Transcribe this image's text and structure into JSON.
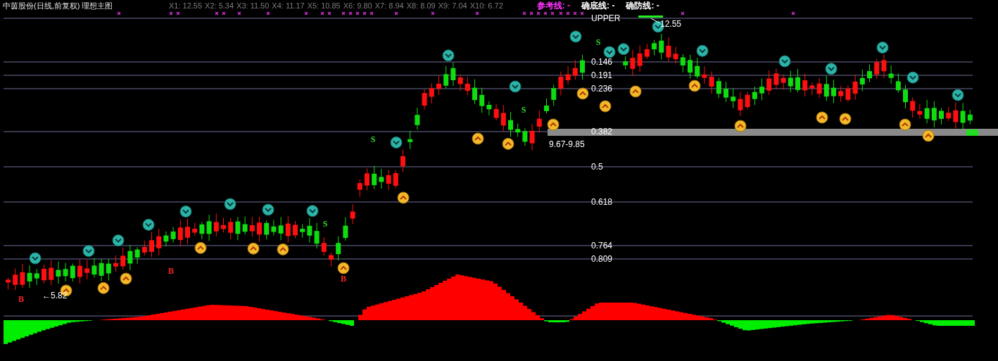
{
  "header": {
    "title": "中茵股份(日线,前复权) 理想主图",
    "indicators": [
      {
        "label": "X1: 12.55"
      },
      {
        "label": "X2: 5.34"
      },
      {
        "label": "X3: 11.50"
      },
      {
        "label": "X4: 11.17"
      },
      {
        "label": "X5: 10.85"
      },
      {
        "label": "X6: 9.80"
      },
      {
        "label": "X7: 8.94"
      },
      {
        "label": "X8: 8.09"
      },
      {
        "label": "X9: 7.04"
      },
      {
        "label": "X10: 6.72"
      }
    ],
    "legend": [
      {
        "label": "参考线: -",
        "color": "#ff33ff"
      },
      {
        "label": "确底线: -",
        "color": "#ffffff"
      },
      {
        "label": "确防线: -",
        "color": "#ffffff"
      }
    ]
  },
  "fib_levels": [
    {
      "label": "0.146"
    },
    {
      "label": "0.191"
    },
    {
      "label": "0.236"
    },
    {
      "label": "0.382"
    },
    {
      "label": "0.5"
    },
    {
      "label": "0.618"
    },
    {
      "label": "0.764"
    },
    {
      "label": "0.809"
    }
  ],
  "annotations": [
    {
      "text": "UPPER"
    },
    {
      "text": "12.55"
    },
    {
      "text": "9.67-9.85"
    },
    {
      "text": "←5.82"
    }
  ],
  "signals": [
    {
      "letter": "S",
      "kind": "sell"
    },
    {
      "letter": "S",
      "kind": "sell"
    },
    {
      "letter": "S",
      "kind": "sell"
    },
    {
      "letter": "S",
      "kind": "sell"
    },
    {
      "letter": "B",
      "kind": "buy"
    },
    {
      "letter": "B",
      "kind": "buy"
    },
    {
      "letter": "B",
      "kind": "buy"
    }
  ]
}
